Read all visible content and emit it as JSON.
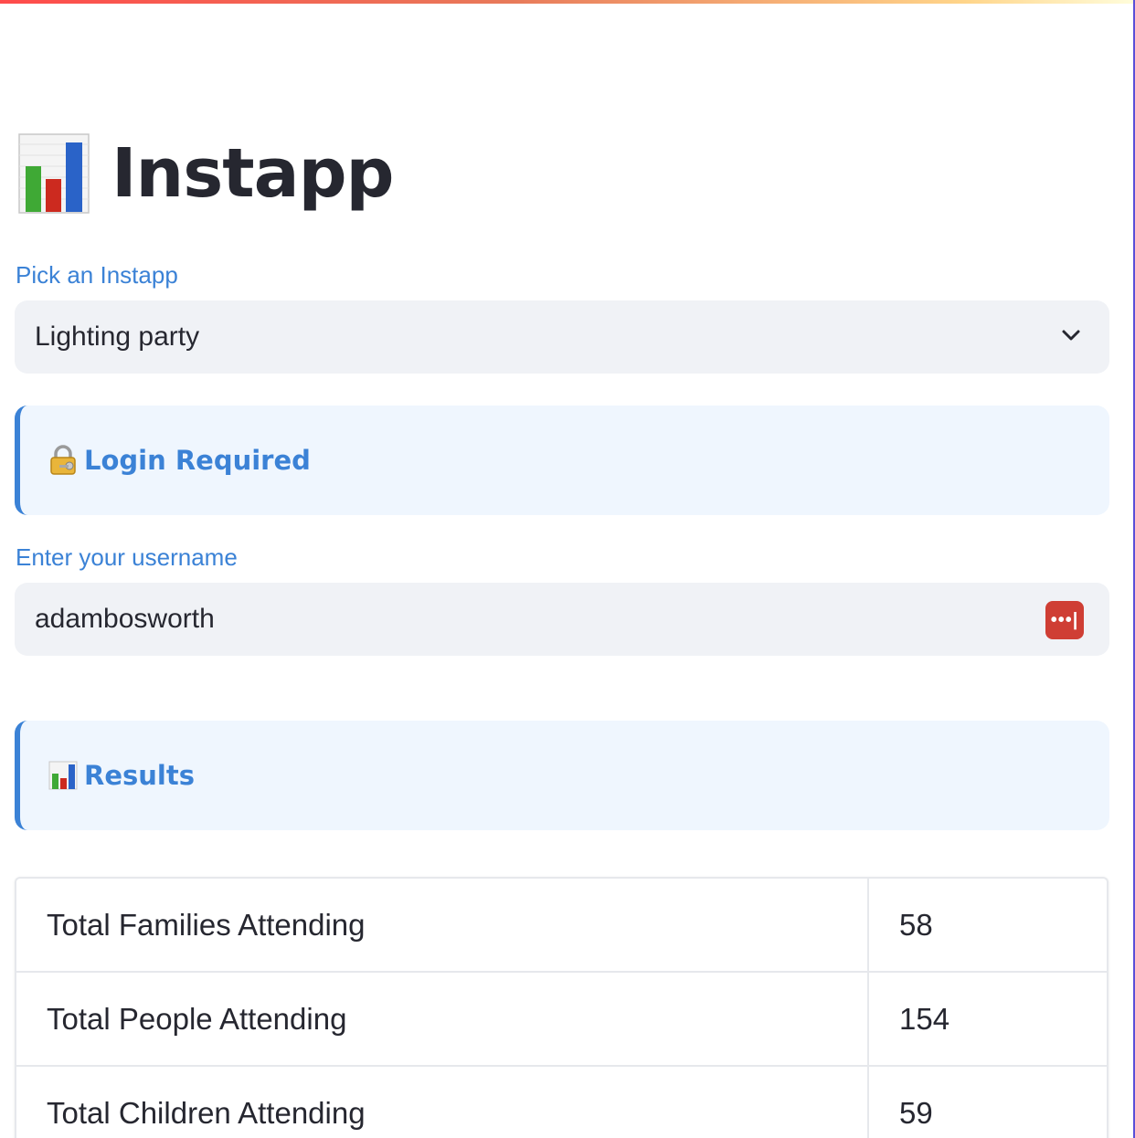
{
  "app": {
    "title": "Instapp",
    "title_icon": "bar-chart-icon"
  },
  "picker": {
    "label": "Pick an Instapp",
    "selected": "Lighting party"
  },
  "login_alert": {
    "icon": "lock-key-icon",
    "text": "Login Required"
  },
  "username": {
    "label": "Enter your username",
    "value": "adambosworth",
    "password_manager_icon": "password-manager-icon"
  },
  "results_alert": {
    "icon": "bar-chart-icon",
    "text": "Results"
  },
  "results_table": {
    "rows": [
      {
        "label": "Total Families Attending",
        "value": "58"
      },
      {
        "label": "Total People Attending",
        "value": "154"
      },
      {
        "label": "Total Children Attending",
        "value": "59"
      }
    ]
  },
  "colors": {
    "accent": "#3b82d6",
    "alert_background": "#eff6fe",
    "input_background": "#f0f2f6",
    "password_badge": "#cf3e34"
  }
}
